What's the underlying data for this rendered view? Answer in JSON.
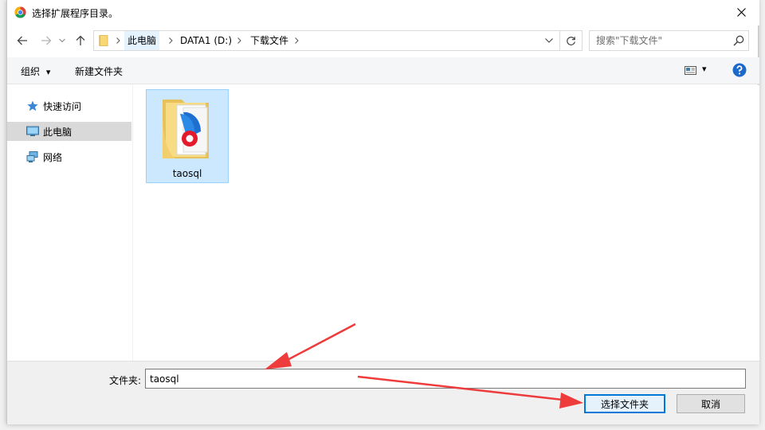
{
  "window": {
    "title": "选择扩展程序目录。",
    "close_symbol": "✕"
  },
  "navigation": {
    "breadcrumb": [
      "此电脑",
      "DATA1 (D:)",
      "下载文件"
    ],
    "search_placeholder": "搜索\"下载文件\""
  },
  "toolbar": {
    "organize_label": "组织",
    "organize_arrow": "▾",
    "new_folder_label": "新建文件夹",
    "view_arrow": "▾"
  },
  "sidebar": {
    "items": [
      {
        "label": "快速访问",
        "icon": "star-icon",
        "selected": false
      },
      {
        "label": "此电脑",
        "icon": "computer-icon",
        "selected": true
      },
      {
        "label": "网络",
        "icon": "network-icon",
        "selected": false
      }
    ]
  },
  "content": {
    "items": [
      {
        "name": "taosql",
        "icon": "folder-with-app-icon",
        "selected": true
      }
    ]
  },
  "footer": {
    "folder_label": "文件夹:",
    "folder_value": "taosql",
    "select_button": "选择文件夹",
    "cancel_button": "取消"
  },
  "colors": {
    "accent": "#0078d7",
    "selection": "#cce8ff",
    "annotation_arrow": "#ee3b3b"
  }
}
